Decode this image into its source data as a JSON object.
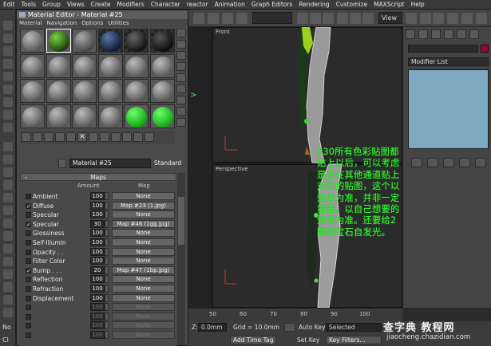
{
  "app_menu": [
    "Edit",
    "Tools",
    "Group",
    "Views",
    "Create",
    "Modifiers",
    "Character",
    "reactor",
    "Animation",
    "Graph Editors",
    "Rendering",
    "Customize",
    "MAXScript",
    "Help"
  ],
  "toolbar": {
    "view_dropdown": "View"
  },
  "material_editor": {
    "title": "Material Editor - Material #25",
    "menu": [
      "Material",
      "Navigation",
      "Options",
      "Utilities"
    ],
    "material_name": "Material #25",
    "material_type": "Standard",
    "maps": {
      "rollout_title": "Maps",
      "collapse_symbol": "-",
      "header_amount": "Amount",
      "header_map": "Map",
      "rows": [
        {
          "name": "Ambient",
          "checked": false,
          "amount": "100",
          "map": "None",
          "dim": false
        },
        {
          "name": "Diffuse",
          "checked": true,
          "amount": "100",
          "map": "Map #23 (1.jpg)",
          "dim": false
        },
        {
          "name": "Specular",
          "checked": false,
          "amount": "100",
          "map": "None",
          "dim": false
        },
        {
          "name": "Specular",
          "checked": true,
          "amount": "30",
          "map": "Map #46 (1gg.jpg)",
          "dim": false
        },
        {
          "name": "Glossiness",
          "checked": false,
          "amount": "100",
          "map": "None",
          "dim": false
        },
        {
          "name": "Self-Illumin",
          "checked": false,
          "amount": "100",
          "map": "None",
          "dim": false
        },
        {
          "name": "Opacity . .",
          "checked": false,
          "amount": "100",
          "map": "None",
          "dim": false
        },
        {
          "name": "Filter Color",
          "checked": false,
          "amount": "100",
          "map": "None",
          "dim": false
        },
        {
          "name": "Bump  . . .",
          "checked": true,
          "amount": "20",
          "map": "Map #47 (1bp.jpg)",
          "dim": false
        },
        {
          "name": "Reflection",
          "checked": false,
          "amount": "100",
          "map": "None",
          "dim": false
        },
        {
          "name": "Refraction",
          "checked": false,
          "amount": "100",
          "map": "None",
          "dim": false
        },
        {
          "name": "Displacement",
          "checked": false,
          "amount": "100",
          "map": "None",
          "dim": false
        },
        {
          "name": "",
          "checked": false,
          "amount": "100",
          "map": "None",
          "dim": true
        },
        {
          "name": "",
          "checked": false,
          "amount": "100",
          "map": "None",
          "dim": true
        },
        {
          "name": "",
          "checked": false,
          "amount": "100",
          "map": "None",
          "dim": true
        },
        {
          "name": "",
          "checked": false,
          "amount": "100",
          "map": "None",
          "dim": true
        }
      ]
    }
  },
  "viewports": {
    "front_label": "Front",
    "perspective_label": "Perspective"
  },
  "overlay_note_lines": [
    "030所有色彩贴图都",
    "贴上以后，可以考虑",
    "是否在其他通道贴上",
    "对应的贴图，这个以",
    "效果为准，并非一定",
    "需要。以自己想要的",
    "效果为准。还要给2",
    "颗绿宝石自发光。"
  ],
  "timeline": {
    "ticks": [
      "50",
      "60",
      "70",
      "80",
      "90",
      "100"
    ]
  },
  "status": {
    "z_label": "Z:",
    "z_value": "0.0mm",
    "grid_label": "Grid = 10.0mm",
    "auto_key": "Auto Key",
    "selected": "Selected",
    "add_time_tag": "Add Time Tag",
    "set_key": "Set Key",
    "key_filters": "Key Filters..."
  },
  "command_panel": {
    "modifier_list": "Modifier List"
  },
  "left_strip": {
    "letters": [
      "No",
      "Cl"
    ]
  },
  "watermark": {
    "brand": "查字典 教程网",
    "url": "jiaocheng.chazidian.com"
  },
  "colors": {
    "overlay_text": "#3ef33e",
    "swatch": "#a1003b",
    "stack_bg": "#7fa9c0"
  }
}
